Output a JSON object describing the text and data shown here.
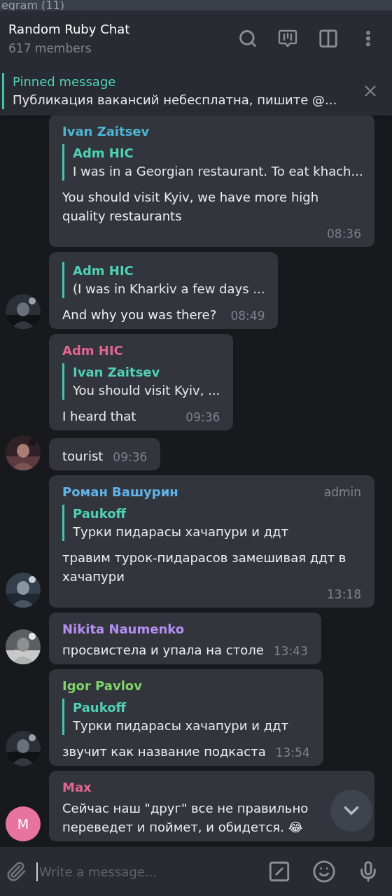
{
  "window": {
    "title": "egram (11)"
  },
  "header": {
    "title": "Random Ruby Chat",
    "subtitle": "617 members"
  },
  "pinned": {
    "label": "Pinned message",
    "text": "Публикация вакансий небесплатна, пишите @..."
  },
  "messages": [
    {
      "sender": {
        "name": "Ivan Zaitsev",
        "color": "#4fb5d6"
      },
      "reply": {
        "name": "Adm HIC",
        "text": "I was in a Georgian restaurant. To eat khach..."
      },
      "text": "You should visit Kyiv, we have more high quality restaurants",
      "time": "08:36"
    },
    {
      "reply": {
        "name": "Adm HIC",
        "text": "(I was in Kharkiv a few days ..."
      },
      "text": "And why you was there?",
      "time": "08:49"
    },
    {
      "sender": {
        "name": "Adm HIC",
        "color": "#e0658f"
      },
      "reply": {
        "name": "Ivan Zaitsev",
        "text": "You should visit Kyiv, ..."
      },
      "text": "I heard that",
      "time": "09:36"
    },
    {
      "text": "tourist",
      "time": "09:36"
    },
    {
      "sender": {
        "name": "Роман Вашурин",
        "color": "#5fb3e8"
      },
      "badge": "admin",
      "reply": {
        "name": "Paukoff",
        "text": "Турки пидарасы хачапури и ддт"
      },
      "text": "травим турок-пидарасов замешивая ддт в хачапури",
      "time": "13:18"
    },
    {
      "sender": {
        "name": "Nikita Naumenko",
        "color": "#b58ef2"
      },
      "text": "просвистела и упала на столе",
      "time": "13:43"
    },
    {
      "sender": {
        "name": "Igor Pavlov",
        "color": "#7fd36b"
      },
      "reply": {
        "name": "Paukoff",
        "text": "Турки пидарасы хачапури и ддт"
      },
      "text": "звучит как название подкаста",
      "time": "13:54"
    },
    {
      "sender": {
        "name": "Max",
        "color": "#e0658f"
      },
      "text": "Сейчас наш \"друг\" все не правильно переведет и поймет, и обидется. 😂",
      "avatar": {
        "kind": "letter",
        "letter": "M",
        "color": "#e8749e"
      }
    }
  ],
  "composer": {
    "placeholder": "Write a message..."
  }
}
